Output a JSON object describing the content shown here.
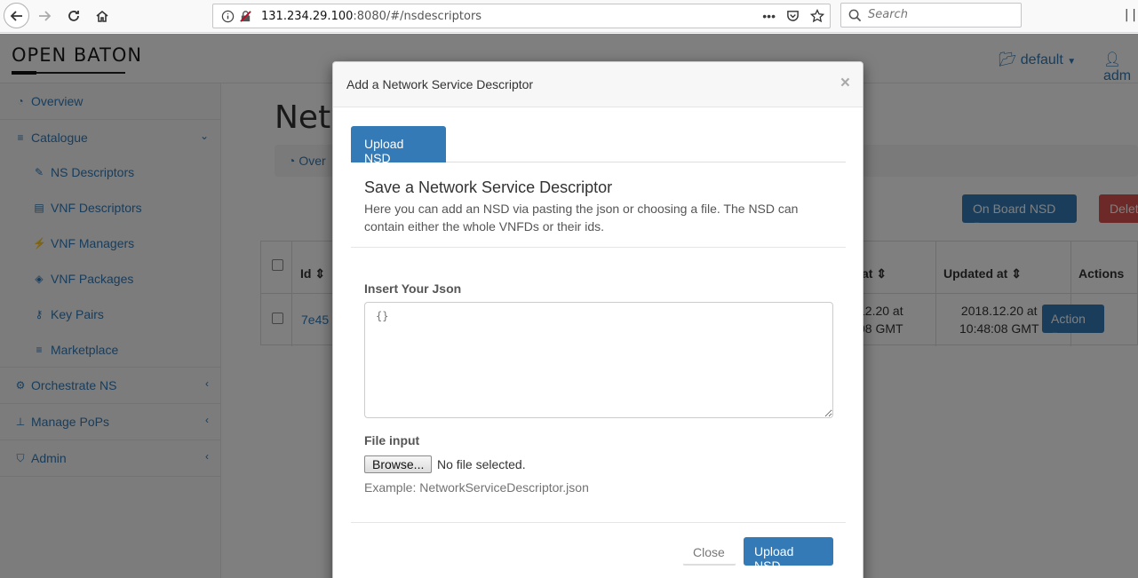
{
  "browser": {
    "url_host": "131.234.29.100",
    "url_rest": ":8080/#/nsdescriptors",
    "search_placeholder": "Search"
  },
  "app": {
    "logo": "OPEN BATON",
    "project": "default",
    "user": "adm"
  },
  "sidebar": {
    "items": [
      {
        "label": "Overview",
        "icon": "dashboard-icon"
      },
      {
        "label": "Catalogue",
        "icon": "database-icon"
      },
      {
        "label": "Orchestrate NS",
        "icon": "cogs-icon"
      },
      {
        "label": "Manage PoPs",
        "icon": "sitemap-icon"
      },
      {
        "label": "Admin",
        "icon": "shield-icon"
      }
    ],
    "catalogue_sub": [
      {
        "label": "NS Descriptors",
        "icon": "edit-icon"
      },
      {
        "label": "VNF Descriptors",
        "icon": "file-icon"
      },
      {
        "label": "VNF Managers",
        "icon": "plug-icon"
      },
      {
        "label": "VNF Packages",
        "icon": "cube-icon"
      },
      {
        "label": "Key Pairs",
        "icon": "key-icon"
      },
      {
        "label": "Marketplace",
        "icon": "database-icon"
      }
    ]
  },
  "main": {
    "title": "Netw",
    "breadcrumb": "Over",
    "onboard_button": "On Board NSD",
    "delete_button": "Delet",
    "table": {
      "headers": [
        "Id",
        "at",
        "Updated at",
        "Actions"
      ],
      "row": {
        "id": "7e45",
        "created_line1": "12.20 at",
        "created_line2": "08 GMT",
        "updated_line1": "2018.12.20 at",
        "updated_line2": "10:48:08 GMT",
        "action": "Action"
      }
    }
  },
  "modal": {
    "title": "Add a Network Service Descriptor",
    "close_symbol": "×",
    "tab": "Upload NSD",
    "section_title": "Save a Network Service Descriptor",
    "section_desc": "Here you can add an NSD via pasting the json or choosing a file. The NSD can contain either the whole VNFDs or their ids.",
    "json_label": "Insert Your Json",
    "json_placeholder": "{}",
    "file_label": "File input",
    "browse_button": "Browse...",
    "file_status": "No file selected.",
    "file_help": "Example: NetworkServiceDescriptor.json",
    "close_button": "Close",
    "upload_button": "Upload NSD"
  }
}
